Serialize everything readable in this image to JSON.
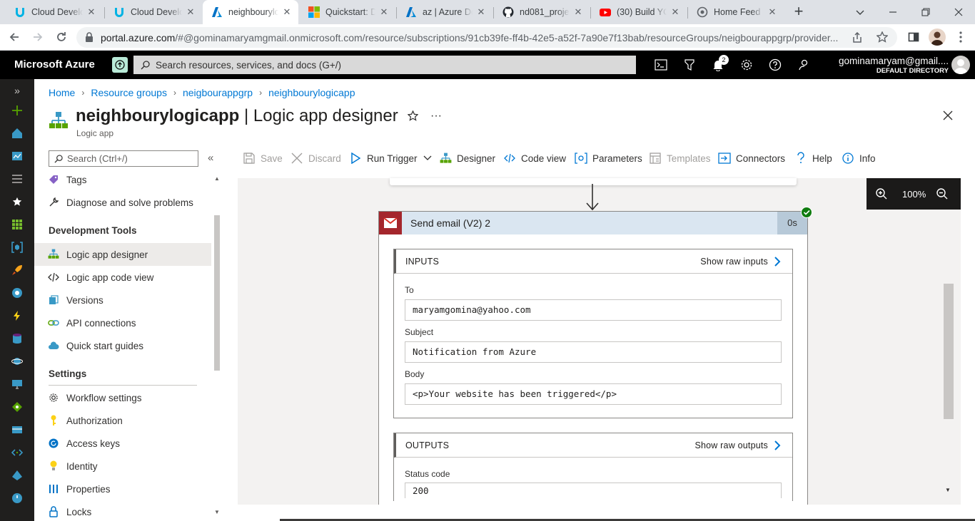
{
  "browser": {
    "tabs": [
      {
        "title": "Cloud Develo",
        "icon": "udacity-icon",
        "active": false
      },
      {
        "title": "Cloud Develo",
        "icon": "udacity-icon",
        "active": false
      },
      {
        "title": "neighbouryloc",
        "icon": "azure-icon",
        "active": true
      },
      {
        "title": "Quickstart: De",
        "icon": "microsoft-icon",
        "active": false
      },
      {
        "title": "az | Azure Do",
        "icon": "azure-icon",
        "active": false
      },
      {
        "title": "nd081_projec",
        "icon": "github-icon",
        "active": false
      },
      {
        "title": "(30) Build YO",
        "icon": "youtube-icon",
        "active": false
      },
      {
        "title": "Home Feed",
        "icon": "globe-icon",
        "active": false
      }
    ],
    "url_host": "portal.azure.com",
    "url_path": "/#@gominamaryamgmail.onmicrosoft.com/resource/subscriptions/91cb39fe-ff4b-42e5-a52f-7a90e7f13bab/resourceGroups/neigbourappgrp/provider..."
  },
  "azure": {
    "brand": "Microsoft Azure",
    "search_placeholder": "Search resources, services, and docs (G+/)",
    "notification_count": "2",
    "account_name": "gominamaryam@gmail....",
    "directory": "DEFAULT DIRECTORY"
  },
  "breadcrumb": [
    "Home",
    "Resource groups",
    "neigbourappgrp",
    "neighbourylogicapp"
  ],
  "page": {
    "resource_name": "neighbourylogicapp",
    "blade_title": " | Logic app designer",
    "subtitle": "Logic app"
  },
  "sidemenu": {
    "search_placeholder": "Search (Ctrl+/)",
    "items_top": [
      {
        "label": "Tags",
        "icon": "tag-icon"
      },
      {
        "label": "Diagnose and solve problems",
        "icon": "wrench-icon"
      }
    ],
    "dev_heading": "Development Tools",
    "dev_items": [
      {
        "label": "Logic app designer",
        "icon": "designer-icon",
        "selected": true
      },
      {
        "label": "Logic app code view",
        "icon": "code-icon"
      },
      {
        "label": "Versions",
        "icon": "versions-icon"
      },
      {
        "label": "API connections",
        "icon": "link-icon"
      },
      {
        "label": "Quick start guides",
        "icon": "cloud-icon"
      }
    ],
    "settings_heading": "Settings",
    "settings_items": [
      {
        "label": "Workflow settings",
        "icon": "gear-icon"
      },
      {
        "label": "Authorization",
        "icon": "key-icon"
      },
      {
        "label": "Access keys",
        "icon": "refresh-icon"
      },
      {
        "label": "Identity",
        "icon": "bulb-icon"
      },
      {
        "label": "Properties",
        "icon": "properties-icon"
      },
      {
        "label": "Locks",
        "icon": "lock-icon"
      }
    ]
  },
  "toolbar": {
    "save": "Save",
    "discard": "Discard",
    "run_trigger": "Run Trigger",
    "designer": "Designer",
    "code_view": "Code view",
    "parameters": "Parameters",
    "templates": "Templates",
    "connectors": "Connectors",
    "help": "Help",
    "info": "Info"
  },
  "zoom": {
    "level": "100%"
  },
  "action_card": {
    "title": "Send email (V2) 2",
    "duration": "0s",
    "status": "succeeded",
    "inputs": {
      "heading": "INPUTS",
      "raw_link": "Show raw inputs",
      "to_label": "To",
      "to_value": "maryamgomina@yahoo.com",
      "subject_label": "Subject",
      "subject_value": "Notification from Azure",
      "body_label": "Body",
      "body_value": "<p>Your website has been triggered</p>"
    },
    "outputs": {
      "heading": "OUTPUTS",
      "raw_link": "Show raw outputs",
      "status_label": "Status code",
      "status_value": "200"
    }
  },
  "colors": {
    "azure_bar": "#000000",
    "accent": "#0078d4",
    "card_header": "#dae6f1",
    "success": "#107c10"
  }
}
